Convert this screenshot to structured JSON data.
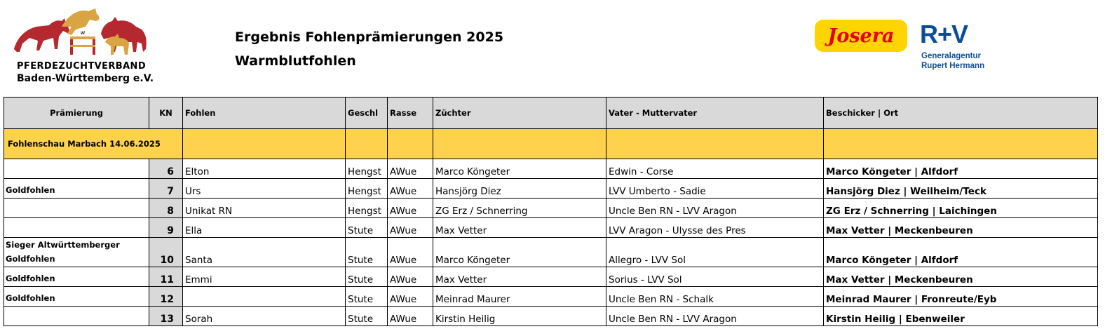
{
  "header": {
    "org_line1": "PFERDEZUCHTVERBAND",
    "org_line2": "Baden-Württemberg e.V.",
    "title": "Ergebnis Fohlenprämierungen 2025",
    "subtitle": "Warmblutfohlen",
    "sponsor1": "Josera",
    "sponsor2_mark": "R+V",
    "sponsor2_line1": "Generalagentur",
    "sponsor2_line2": "Rupert Hermann"
  },
  "colors": {
    "section_bg": "#ffd24d",
    "header_bg": "#d9d9d9",
    "josera_red": "#e2001a",
    "rv_blue": "#0b4d9a",
    "logo_red": "#b5282f",
    "logo_gold": "#d9a441"
  },
  "table": {
    "columns": [
      "Prämierung",
      "KN",
      "Fohlen",
      "Geschl",
      "Rasse",
      "Züchter",
      "Vater - Muttervater",
      "Beschicker | Ort"
    ],
    "section": "Fohlenschau Marbach 14.06.2025",
    "rows": [
      {
        "praemierung": "",
        "kn": "6",
        "fohlen": "Elton",
        "geschl": "Hengst",
        "rasse": "AWue",
        "zuechter": "Marco Köngeter",
        "vater": "Edwin - Corse",
        "beschicker": "Marco Köngeter | Alfdorf"
      },
      {
        "praemierung": "Goldfohlen",
        "kn": "7",
        "fohlen": "Urs",
        "geschl": "Hengst",
        "rasse": "AWue",
        "zuechter": "Hansjörg Diez",
        "vater": "LVV Umberto - Sadie",
        "beschicker": "Hansjörg Diez | Weilheim/Teck"
      },
      {
        "praemierung": "",
        "kn": "8",
        "fohlen": "Unikat RN",
        "geschl": "Hengst",
        "rasse": "AWue",
        "zuechter": "ZG Erz / Schnerring",
        "vater": "Uncle Ben RN - LVV Aragon",
        "beschicker": "ZG Erz / Schnerring | Laichingen"
      },
      {
        "praemierung": "",
        "kn": "9",
        "fohlen": "Ella",
        "geschl": "Stute",
        "rasse": "AWue",
        "zuechter": "Max Vetter",
        "vater": "LVV Aragon - Ulysse des Pres",
        "beschicker": "Max Vetter | Meckenbeuren"
      },
      {
        "praemierung_line1": "Sieger Altwürttemberger",
        "praemierung_line2": "Goldfohlen",
        "kn": "10",
        "fohlen": "Santa",
        "geschl": "Stute",
        "rasse": "AWue",
        "zuechter": "Marco Köngeter",
        "vater": "Allegro - LVV Sol",
        "beschicker": "Marco Köngeter | Alfdorf"
      },
      {
        "praemierung": "Goldfohlen",
        "kn": "11",
        "fohlen": "Emmi",
        "geschl": "Stute",
        "rasse": "AWue",
        "zuechter": "Max Vetter",
        "vater": "Sorius - LVV Sol",
        "beschicker": "Max Vetter | Meckenbeuren"
      },
      {
        "praemierung": "Goldfohlen",
        "kn": "12",
        "fohlen": "",
        "geschl": "Stute",
        "rasse": "AWue",
        "zuechter": "Meinrad Maurer",
        "vater": "Uncle Ben RN - Schalk",
        "beschicker": "Meinrad Maurer | Fronreute/Eyb"
      },
      {
        "praemierung": "",
        "kn": "13",
        "fohlen": "Sorah",
        "geschl": "Stute",
        "rasse": "AWue",
        "zuechter": "Kirstin Heilig",
        "vater": "Uncle Ben RN - LVV Aragon",
        "beschicker": "Kirstin Heilig | Ebenweiler"
      }
    ]
  }
}
